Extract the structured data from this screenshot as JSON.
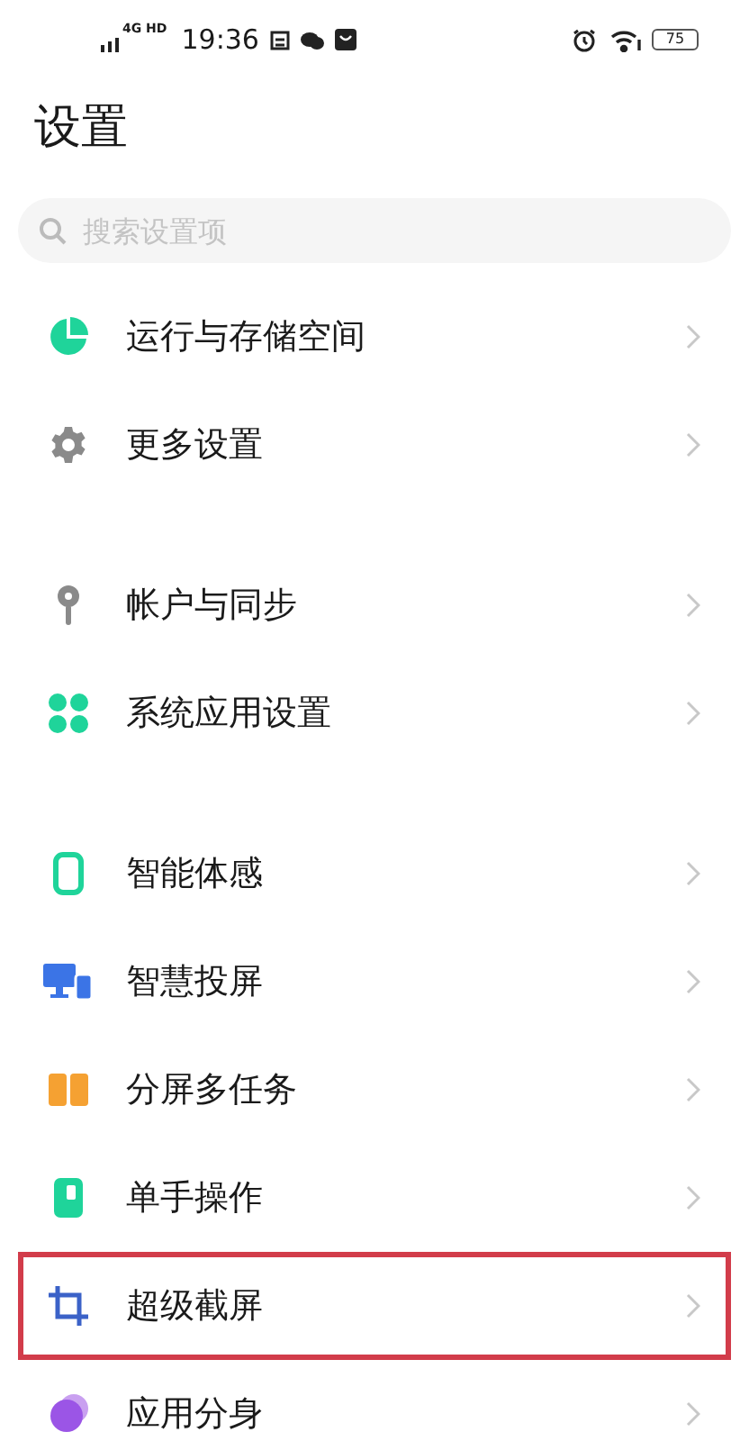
{
  "status_bar": {
    "network": "4G HD",
    "time": "19:36",
    "battery": "75"
  },
  "title": "设置",
  "search": {
    "placeholder": "搜索设置项"
  },
  "groups": [
    {
      "items": [
        {
          "label": "运行与存储空间",
          "kind": "pie",
          "highlighted": false
        },
        {
          "label": "更多设置",
          "kind": "gear",
          "highlighted": false
        }
      ]
    },
    {
      "items": [
        {
          "label": "帐户与同步",
          "kind": "key",
          "highlighted": false
        },
        {
          "label": "系统应用设置",
          "kind": "clover",
          "highlighted": false
        }
      ]
    },
    {
      "items": [
        {
          "label": "智能体感",
          "kind": "phone",
          "highlighted": false
        },
        {
          "label": "智慧投屏",
          "kind": "monitor",
          "highlighted": false
        },
        {
          "label": "分屏多任务",
          "kind": "split",
          "highlighted": false
        },
        {
          "label": "单手操作",
          "kind": "onehand",
          "highlighted": false
        },
        {
          "label": "超级截屏",
          "kind": "crop",
          "highlighted": true
        },
        {
          "label": "应用分身",
          "kind": "circles",
          "highlighted": false
        }
      ]
    }
  ]
}
